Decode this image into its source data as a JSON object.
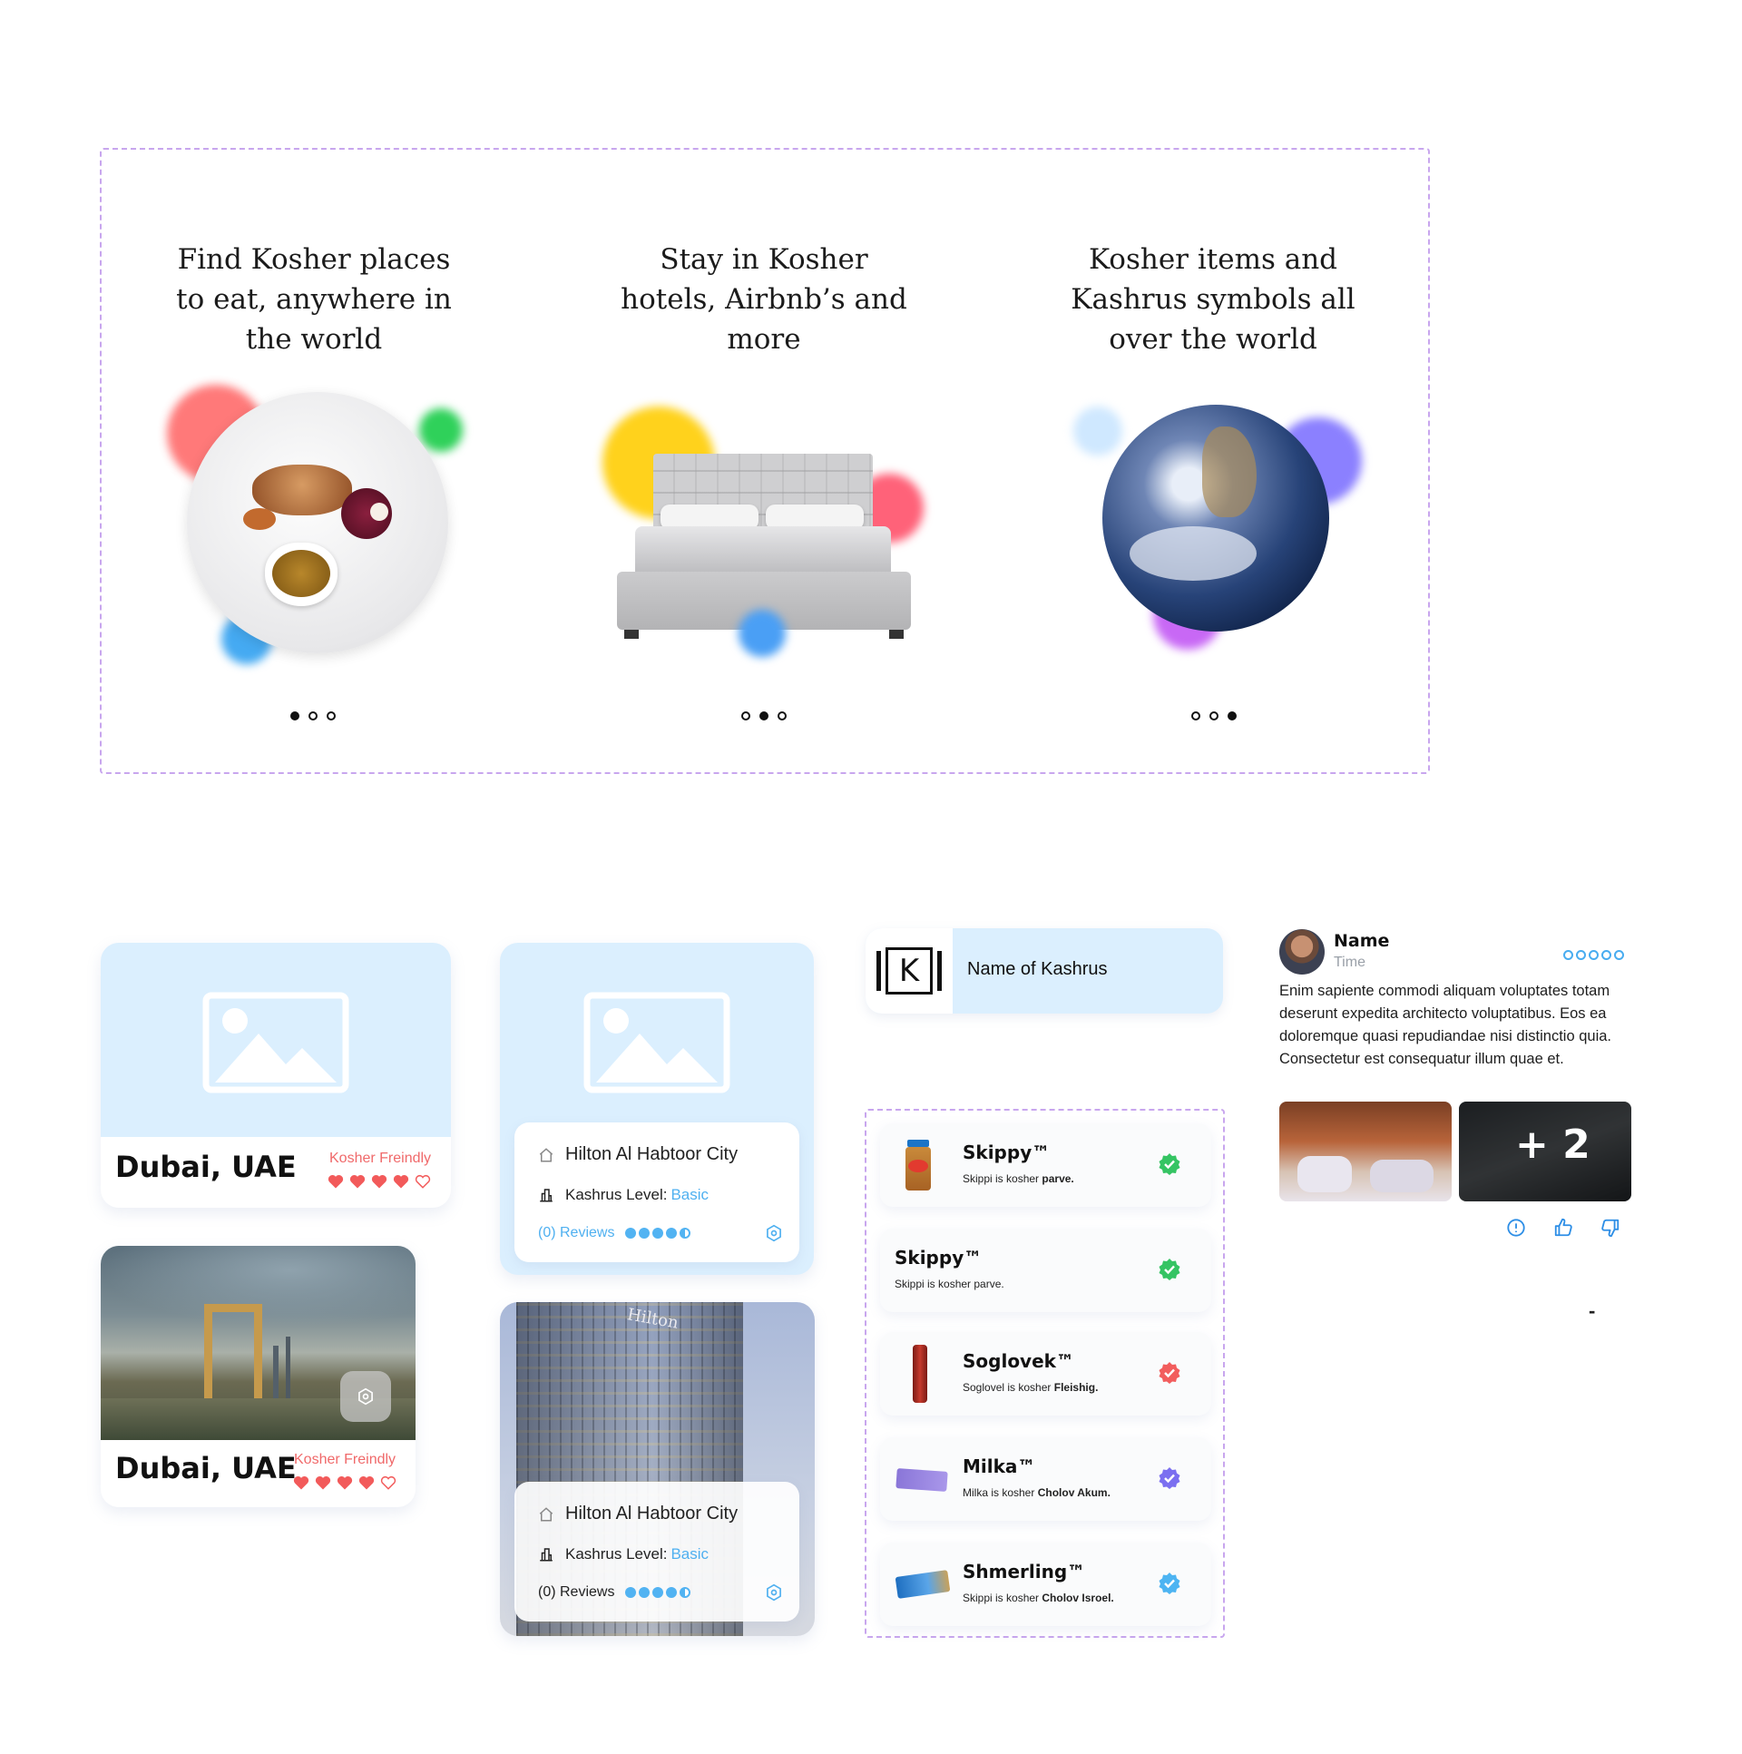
{
  "onboarding": [
    {
      "title": "Find Kosher places to eat, anywhere in the world",
      "image": "food-plate-image",
      "active_dot": 0
    },
    {
      "title": "Stay in Kosher hotels, Airbnb’s and more",
      "image": "bed-image",
      "active_dot": 1
    },
    {
      "title": "Kosher items and Kashrus symbols all over the world",
      "image": "earth-image",
      "active_dot": 2
    }
  ],
  "city_cards": [
    {
      "city": "Dubai, UAE",
      "kosher_label": "Kosher Freindly",
      "hearts_filled": 4,
      "hearts_total": 5
    },
    {
      "city": "Dubai, UAE",
      "kosher_label": "Kosher Freindly",
      "hearts_filled": 4,
      "hearts_total": 5
    }
  ],
  "hotel_cards": [
    {
      "name": "Hilton Al Habtoor City",
      "kashrus_prefix": "Kashrus Level:",
      "kashrus_level": "Basic",
      "reviews": "(0) Reviews",
      "rating": 4.5
    },
    {
      "name": "Hilton Al Habtoor City",
      "kashrus_prefix": "Kashrus Level:",
      "kashrus_level": "Basic",
      "reviews": "(0) Reviews",
      "rating": 4.5,
      "photo_sign": "Hilton"
    }
  ],
  "kashrus": {
    "logo_letter": "K",
    "name": "Name of Kashrus"
  },
  "products": [
    {
      "name": "Skippy™",
      "desc_prefix": "Skippi is kosher",
      "desc_bold": "parve.",
      "status_color": "#35c463",
      "has_image": true
    },
    {
      "name": "Skippy™",
      "desc_prefix": "Skippi is kosher parve.",
      "desc_bold": "",
      "status_color": "#35c463",
      "has_image": false
    },
    {
      "name": "Soglovek™",
      "desc_prefix": "Soglovel is kosher",
      "desc_bold": "Fleishig.",
      "status_color": "#f25d5d",
      "has_image": true
    },
    {
      "name": "Milka™",
      "desc_prefix": "Milka is kosher",
      "desc_bold": "Cholov Akum.",
      "status_color": "#7b6ff0",
      "has_image": true
    },
    {
      "name": "Shmerling™",
      "desc_prefix": "Skippi is kosher",
      "desc_bold": "Cholov Isroel.",
      "status_color": "#4db4f2",
      "has_image": true
    }
  ],
  "review": {
    "name": "Name",
    "time": "Time",
    "stars_total": 5,
    "text": "Enim sapiente commodi aliquam voluptates totam deserunt expedita architecto voluptatibus. Eos ea doloremque quasi repudiandae nisi distinctio quia. Consectetur est consequatur illum quae et.",
    "more_photos": "+ 2",
    "dash": "-"
  },
  "colors": {
    "light_blue": "#dbeffe",
    "accent_blue": "#4fb0f0",
    "kosher_red": "#f0696a",
    "dashed_border": "#c8a6ee"
  }
}
